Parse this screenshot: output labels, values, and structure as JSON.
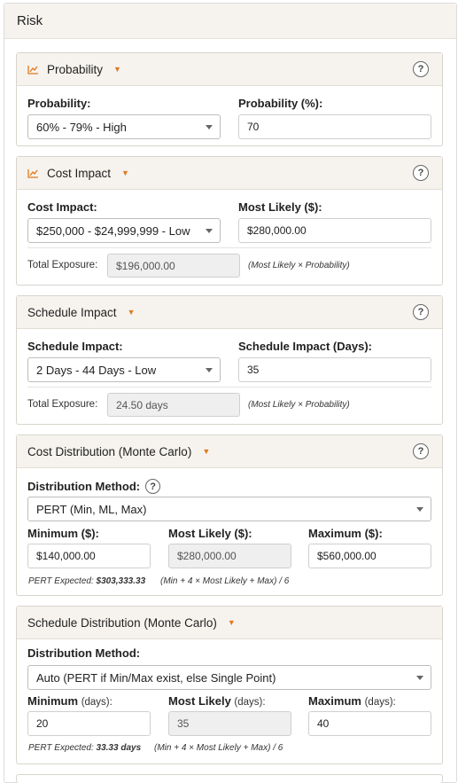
{
  "section_title": "Risk",
  "probability": {
    "title": "Probability",
    "prob_label": "Probability:",
    "prob_value": "60% - 79% - High",
    "pct_label": "Probability (%):",
    "pct_value": "70"
  },
  "cost_impact": {
    "title": "Cost Impact",
    "impact_label": "Cost Impact:",
    "impact_value": "$250,000 - $24,999,999 - Low",
    "ml_label": "Most Likely ($):",
    "ml_value": "$280,000.00",
    "exposure_label": "Total Exposure:",
    "exposure_value": "$196,000.00",
    "exposure_note": "(Most Likely × Probability)"
  },
  "schedule_impact": {
    "title": "Schedule Impact",
    "impact_label": "Schedule Impact:",
    "impact_value": "2 Days - 44 Days - Low",
    "days_label": "Schedule Impact (Days):",
    "days_value": "35",
    "exposure_label": "Total Exposure:",
    "exposure_value": "24.50 days",
    "exposure_note": "(Most Likely × Probability)"
  },
  "cost_distribution": {
    "title": "Cost Distribution (Monte Carlo)",
    "method_label": "Distribution Method:",
    "method_value": "PERT (Min, ML, Max)",
    "min_label": "Minimum ($):",
    "min_value": "$140,000.00",
    "ml_label": "Most Likely ($):",
    "ml_value": "$280,000.00",
    "max_label": "Maximum ($):",
    "max_value": "$560,000.00",
    "pert_prefix": "PERT Expected: ",
    "pert_value": "$303,333.33",
    "pert_formula": "(Min + 4 × Most Likely + Max) / 6"
  },
  "schedule_distribution": {
    "title": "Schedule Distribution (Monte Carlo)",
    "method_label": "Distribution Method:",
    "method_value": "Auto (PERT if Min/Max exist, else Single Point)",
    "min_label": "Minimum",
    "ml_label": "Most Likely",
    "max_label": "Maximum",
    "unit": "(days):",
    "min_value": "20",
    "ml_value": "35",
    "max_value": "40",
    "pert_prefix": "PERT Expected: ",
    "pert_value": "33.33 days",
    "pert_formula": "(Min + 4 × Most Likely + Max) / 6"
  },
  "icons": {
    "chart": "line-chart-icon",
    "caret": "caret-down-icon",
    "help": "help-circle-icon"
  },
  "colors": {
    "accent": "#e07a1f",
    "header_bg": "#f6f3ee"
  }
}
